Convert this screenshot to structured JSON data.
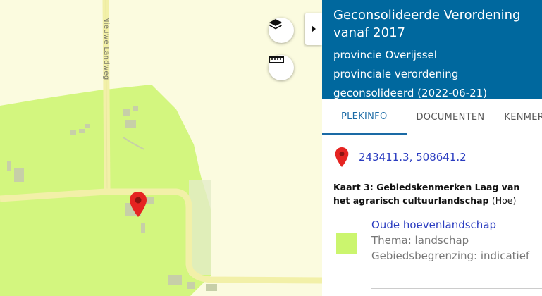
{
  "map": {
    "road_label": "Nieuwe Landweg",
    "region_color": "#cbf56e",
    "marker_color": "#e52421"
  },
  "controls": {
    "layers_icon": "layers-icon",
    "measure_icon": "ruler-icon",
    "toggle_icon": "caret-right-icon"
  },
  "panel": {
    "title": "Geconsolideerde Verordening vanaf 2017",
    "subtitle_lines": [
      "provincie Overijssel",
      "provinciale verordening",
      "geconsolideerd (2022-06-21)"
    ],
    "header_color": "#00689e",
    "tabs": [
      {
        "label": "PLEKINFO",
        "active": true
      },
      {
        "label": "DOCUMENTEN",
        "active": false
      },
      {
        "label": "KENMERKEN",
        "active": false
      }
    ],
    "coordinates": "243411.3, 508641.2",
    "kaart_title": "Kaart 3: Gebiedskenmerken Laag van het agrarisch cultuurlandschap",
    "kaart_suffix": "(Hoe)",
    "legend": {
      "name": "Oude hoevenlandschap",
      "thema": "Thema: landschap",
      "gebiedsbegrenzing": "Gebiedsbegrenzing: indicatief"
    }
  }
}
